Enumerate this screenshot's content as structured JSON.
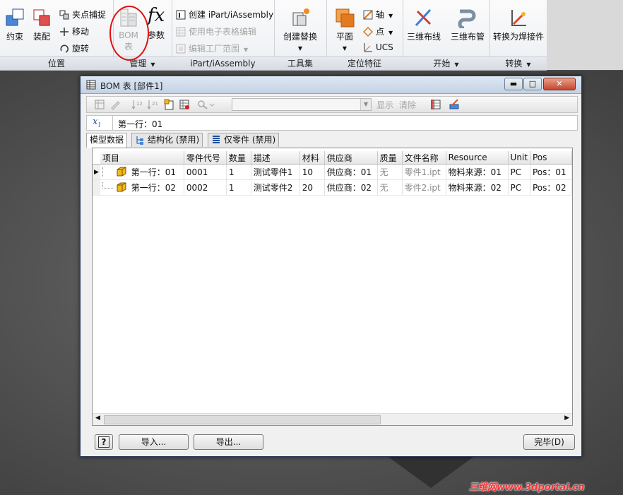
{
  "ribbon": {
    "panels": [
      {
        "label": "位置",
        "buttons": {
          "constrain": "约束",
          "assemble": "装配"
        },
        "small": [
          "夹点捕捉",
          "移动",
          "旋转"
        ]
      },
      {
        "label": "管理",
        "buttons": {
          "bom_line1": "BOM",
          "bom_line2": "表",
          "params": "参数"
        }
      },
      {
        "label": "iPart/iAssembly",
        "small": [
          "创建 iPart/iAssembly",
          "使用电子表格编辑",
          "编辑工厂范围"
        ]
      },
      {
        "label": "工具集",
        "buttons": {
          "create_sub": "创建替换"
        }
      },
      {
        "label": "定位特征",
        "buttons": {
          "plane": "平面"
        },
        "small": [
          "轴",
          "点",
          "UCS"
        ]
      },
      {
        "label": "开始",
        "buttons": {
          "cable": "三维布线",
          "pipe": "三维布管"
        }
      },
      {
        "label": "转换",
        "buttons": {
          "weld": "转换为焊接件"
        }
      }
    ]
  },
  "dialog": {
    "title": "BOM 表 [部件1]",
    "toolbar": {
      "show": "显示",
      "clear": "清除"
    },
    "formula_value": "第一行：01",
    "tabs": [
      "模型数据",
      "结构化 (禁用)",
      "仅零件 (禁用)"
    ],
    "columns": [
      "项目",
      "零件代号",
      "数量",
      "描述",
      "材料",
      "供应商",
      "质量",
      "文件名称",
      "Resource",
      "Unit",
      "Pos"
    ],
    "rows": [
      [
        "第一行：01",
        "0001",
        "1",
        "测试零件1",
        "10",
        "供应商：01",
        "无",
        "零件1.ipt",
        "物料来源：01",
        "PC",
        "Pos：01"
      ],
      [
        "第一行：02",
        "0002",
        "1",
        "测试零件2",
        "20",
        "供应商：02",
        "无",
        "零件2.ipt",
        "物料来源：02",
        "PC",
        "Pos：02"
      ]
    ],
    "buttons": {
      "help": "?",
      "import": "导入...",
      "export": "导出...",
      "done": "完毕(D)"
    }
  },
  "watermark": "三维网www.3dportal.cn",
  "colors": {
    "part_icon": "#f2b91e",
    "highlight_circle": "#e21010"
  }
}
